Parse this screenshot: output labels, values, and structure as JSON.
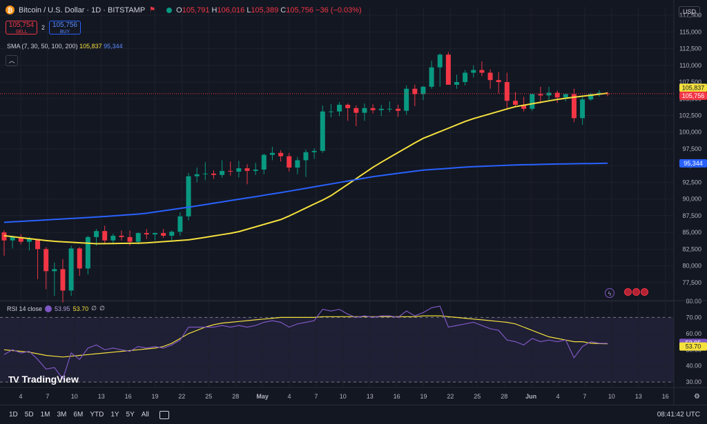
{
  "header": {
    "symbol_icon": "bitcoin-icon",
    "title": "Bitcoin / U.S. Dollar · 1D · BITSTAMP",
    "flag_icon": "flag-icon",
    "ohlc": {
      "o_label": "O",
      "o": "105,791",
      "h_label": "H",
      "h": "106,016",
      "l_label": "L",
      "l": "105,389",
      "c_label": "C",
      "c": "105,756",
      "change": "−36 (−0.03%)"
    },
    "sell_price": "105,754",
    "sell_label": "SELL",
    "spread": "2",
    "buy_price": "105,756",
    "buy_label": "BUY",
    "currency": "USD",
    "collapse_icon": "chevron-up-icon"
  },
  "sma_legend": {
    "label": "SMA (7, 30, 50, 100, 200)",
    "v1": "105,837",
    "v2": "95,344"
  },
  "rsi_legend": {
    "label": "RSI 14 close",
    "eye_icon": "eye-icon",
    "v1": "53.95",
    "v2": "53.70",
    "v3": "∅",
    "v4": "∅"
  },
  "bottom_bar": {
    "timeframes": [
      "1D",
      "5D",
      "1M",
      "3M",
      "6M",
      "YTD",
      "1Y",
      "5Y",
      "All"
    ],
    "calendar_icon": "calendar-icon",
    "time": "08:41:42 UTC"
  },
  "branding": {
    "logo_mark": "TV",
    "logo_text": "TradingView"
  },
  "colors": {
    "up": "#089981",
    "down": "#f23645",
    "sma_fast": "#f5e13d",
    "sma_slow": "#2962ff",
    "rsi": "#7e57c2",
    "rsi_ma": "#f5e13d",
    "bg": "#131722"
  },
  "chart_data": [
    {
      "type": "candlestick",
      "title": "Bitcoin / U.S. Dollar · 1D · BITSTAMP",
      "ylim": [
        75000,
        118750
      ],
      "y_ticks": [
        77500,
        80000,
        82500,
        85000,
        87500,
        90000,
        92500,
        95000,
        97500,
        100000,
        102500,
        105000,
        107500,
        110000,
        112500,
        115000,
        117500
      ],
      "y_tick_labels": [
        "77,500",
        "80,000",
        "82,500",
        "85,000",
        "87,500",
        "90,000",
        "92,500",
        "95,000",
        "97,500",
        "100,000",
        "102,500",
        "105,000",
        "107,500",
        "110,000",
        "112,500",
        "115,000",
        "117,500"
      ],
      "x_ticks": [
        "4",
        "7",
        "10",
        "13",
        "16",
        "19",
        "22",
        "25",
        "28",
        "May",
        "4",
        "7",
        "10",
        "13",
        "16",
        "19",
        "22",
        "25",
        "28",
        "Jun",
        "4",
        "7",
        "10",
        "13",
        "16"
      ],
      "candles": [
        [
          85000,
          85300,
          81500,
          83800
        ],
        [
          83800,
          84500,
          82600,
          84300
        ],
        [
          84300,
          84700,
          83200,
          83600
        ],
        [
          83600,
          84300,
          82300,
          84000
        ],
        [
          84000,
          84000,
          78000,
          82500
        ],
        [
          82500,
          82800,
          76500,
          79200
        ],
        [
          79200,
          80500,
          75500,
          79500
        ],
        [
          79500,
          81000,
          74500,
          76300
        ],
        [
          76300,
          83000,
          75500,
          82600
        ],
        [
          82600,
          82800,
          78500,
          79600
        ],
        [
          79600,
          84500,
          78700,
          84300
        ],
        [
          84300,
          85500,
          83000,
          85200
        ],
        [
          85200,
          86000,
          83200,
          83800
        ],
        [
          83800,
          84800,
          83200,
          84500
        ],
        [
          84500,
          85300,
          83800,
          84300
        ],
        [
          84300,
          85300,
          83000,
          83600
        ],
        [
          83600,
          85000,
          83200,
          84900
        ],
        [
          84900,
          85500,
          84000,
          84700
        ],
        [
          84700,
          85000,
          83800,
          84900
        ],
        [
          84900,
          85500,
          84200,
          84500
        ],
        [
          84500,
          85300,
          83600,
          85100
        ],
        [
          85100,
          88000,
          84500,
          87400
        ],
        [
          87400,
          93900,
          86800,
          93400
        ],
        [
          93400,
          94700,
          92500,
          93700
        ],
        [
          93700,
          95500,
          92800,
          93800
        ],
        [
          93800,
          94300,
          93000,
          93600
        ],
        [
          93600,
          95800,
          93200,
          94200
        ],
        [
          94200,
          95600,
          93500,
          94100
        ],
        [
          94100,
          95700,
          93200,
          94600
        ],
        [
          94600,
          95200,
          92200,
          94200
        ],
        [
          94200,
          95400,
          93600,
          94400
        ],
        [
          94400,
          96800,
          93700,
          96600
        ],
        [
          96600,
          97800,
          95800,
          96900
        ],
        [
          96900,
          97300,
          95600,
          96400
        ],
        [
          96400,
          96900,
          94100,
          94700
        ],
        [
          94700,
          96300,
          93700,
          95800
        ],
        [
          95800,
          97400,
          93300,
          97000
        ],
        [
          97000,
          97600,
          96000,
          97200
        ],
        [
          97200,
          104000,
          96900,
          103100
        ],
        [
          103100,
          104200,
          102200,
          103100
        ],
        [
          103100,
          104500,
          102400,
          104100
        ],
        [
          104100,
          104300,
          101700,
          103600
        ],
        [
          103600,
          104000,
          100900,
          102900
        ],
        [
          102900,
          104300,
          101700,
          103600
        ],
        [
          103600,
          104200,
          102800,
          103300
        ],
        [
          103300,
          104100,
          102400,
          103500
        ],
        [
          103500,
          104600,
          103000,
          103500
        ],
        [
          103500,
          104100,
          102300,
          103200
        ],
        [
          103200,
          107000,
          102600,
          106500
        ],
        [
          106500,
          107100,
          103900,
          105700
        ],
        [
          105700,
          106900,
          104800,
          106800
        ],
        [
          106800,
          110700,
          106500,
          109700
        ],
        [
          109700,
          111800,
          106800,
          111600
        ],
        [
          111600,
          112000,
          107500,
          107100
        ],
        [
          107100,
          108600,
          106500,
          107500
        ],
        [
          107500,
          109300,
          107000,
          108900
        ],
        [
          108900,
          110000,
          108200,
          109300
        ],
        [
          109300,
          110600,
          108400,
          108900
        ],
        [
          108900,
          109400,
          106500,
          107800
        ],
        [
          107800,
          109000,
          105800,
          107500
        ],
        [
          107500,
          108900,
          103400,
          104700
        ],
        [
          104700,
          106000,
          103700,
          104100
        ],
        [
          104100,
          105300,
          103100,
          103500
        ],
        [
          103500,
          105600,
          103200,
          105700
        ],
        [
          105700,
          106800,
          104300,
          105500
        ],
        [
          105500,
          106800,
          104700,
          105900
        ],
        [
          105900,
          106200,
          104400,
          105200
        ],
        [
          105200,
          105600,
          104600,
          105700
        ],
        [
          105700,
          106500,
          101500,
          102100
        ],
        [
          102100,
          105500,
          101100,
          104900
        ],
        [
          104900,
          105900,
          104700,
          105700
        ],
        [
          105700,
          106300,
          105300,
          105900
        ],
        [
          105791,
          106016,
          105389,
          105756
        ]
      ],
      "series": [
        {
          "name": "SMA",
          "values_start": [
            84500,
            83700,
            83300,
            83400,
            83900,
            85000,
            87000,
            90300,
            95000,
            99000,
            101800,
            103800,
            105000,
            105837
          ],
          "last": "105,837"
        },
        {
          "name": "SMA",
          "values_start": [
            86500,
            86900,
            87300,
            87800,
            88800,
            89900,
            91000,
            92200,
            93400,
            94300,
            94800,
            95100,
            95250,
            95344
          ],
          "last": "95,344"
        }
      ],
      "last_price": "105,756"
    },
    {
      "type": "line",
      "title": "RSI 14 close",
      "ylim": [
        27.5,
        80
      ],
      "y_ticks": [
        30,
        40,
        50,
        60,
        70,
        80
      ],
      "y_tick_labels": [
        "30.00",
        "40.00",
        "50.00",
        "60.00",
        "70.00",
        "80.00"
      ],
      "bands": [
        30,
        70
      ],
      "series": [
        {
          "name": "RSI",
          "values": [
            47,
            50,
            48,
            49,
            44,
            38,
            39,
            32,
            48,
            44,
            51,
            53,
            50,
            51,
            50,
            49,
            52,
            51,
            52,
            51,
            53,
            56,
            64,
            64,
            64,
            64,
            65,
            64,
            65,
            64,
            65,
            67,
            68,
            67,
            64,
            66,
            67,
            68,
            75,
            74,
            75,
            72,
            70,
            71,
            70,
            71,
            71,
            70,
            74,
            71,
            73,
            76,
            77,
            64,
            65,
            66,
            67,
            65,
            63,
            62,
            56,
            55,
            53,
            57,
            55,
            56,
            55,
            56,
            45,
            52,
            55,
            54,
            53.95
          ]
        },
        {
          "name": "RSI-based MA",
          "values": [
            50,
            49.5,
            49,
            48.5,
            47.5,
            46.5,
            46,
            45.5,
            46,
            46.5,
            47,
            47.5,
            48,
            48.5,
            49,
            49.5,
            50,
            50.5,
            51,
            52,
            54,
            57,
            60,
            62,
            64,
            65.5,
            66.5,
            67,
            67.5,
            68,
            68.5,
            69,
            69.5,
            70,
            70,
            70,
            70,
            70,
            70.5,
            70.5,
            70.5,
            70.5,
            70.5,
            70.5,
            70.5,
            70.5,
            70.5,
            70.5,
            70.5,
            70.5,
            71,
            71,
            71,
            70.5,
            70,
            69.5,
            69,
            68.5,
            68,
            67.5,
            67,
            66,
            64,
            62,
            60,
            58,
            57,
            56,
            55,
            55,
            54,
            53.8,
            53.7
          ]
        }
      ],
      "labels": [
        "53.95",
        "53.70"
      ]
    }
  ]
}
